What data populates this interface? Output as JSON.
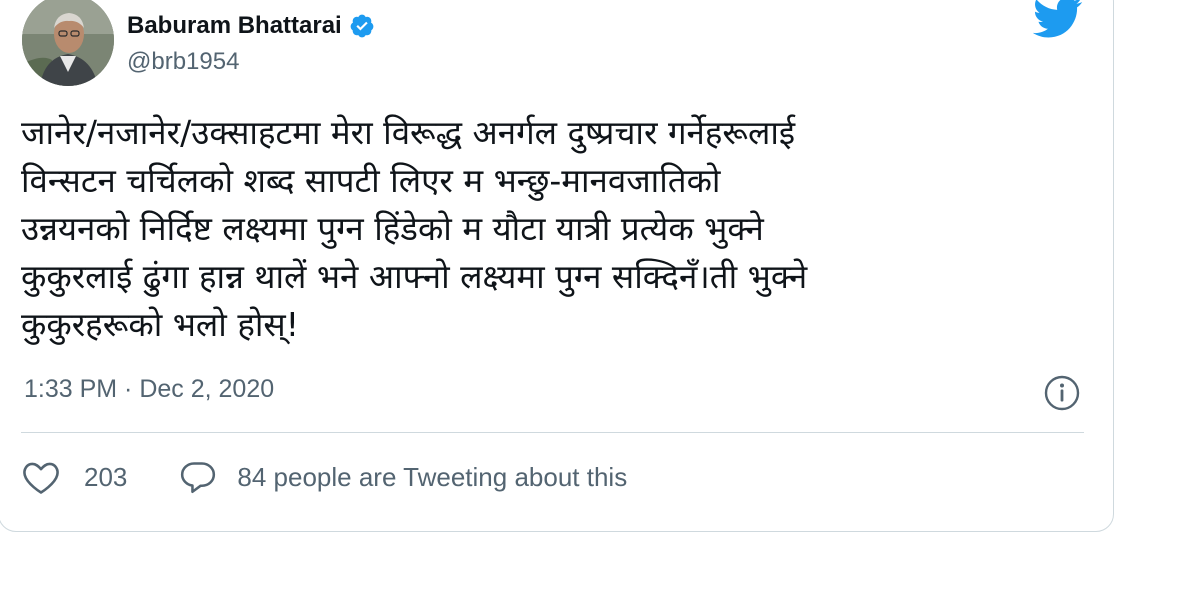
{
  "tweet": {
    "author": {
      "display_name": "Baburam Bhattarai",
      "handle": "@brb1954",
      "verified": true
    },
    "text": "जानेर/नजानेर/उक्साहटमा मेरा विरूद्ध अनर्गल दुष्प्रचार गर्नेहरूलाई\nविन्सटन चर्चिलको शब्द सापटी लिएर म भन्छु-मानवजातिको\nउन्नयनको निर्दिष्ट लक्ष्यमा पुग्न हिंडेको म यौटा यात्री प्रत्येक भुक्ने\nकुकुरलाई ढुंगा हान्न थालें भने आफ्नो लक्ष्यमा पुग्न सक्दिनँ।ती भुक्ने\nकुकुरहरूको भलो होस्!",
    "timestamp": "1:33 PM · Dec 2, 2020",
    "likes": "203",
    "conversation": "84 people are Tweeting about this"
  },
  "icons": {
    "avatar": "avatar",
    "verified": "verified-badge-icon",
    "brand": "twitter-bird-icon",
    "info": "info-icon",
    "like": "heart-icon",
    "reply": "speech-bubble-icon"
  },
  "colors": {
    "accent": "#1d9bf0",
    "text": "#0f1419",
    "secondary": "#536471",
    "border": "#cfd9de"
  }
}
